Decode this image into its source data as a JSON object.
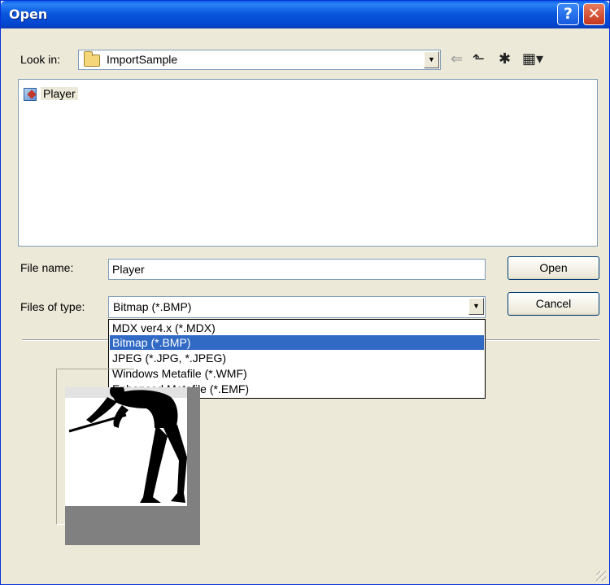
{
  "window": {
    "title": "Open",
    "help_glyph": "?",
    "close_glyph": "✕"
  },
  "lookin": {
    "label": "Look in:",
    "value": "ImportSample",
    "folder_icon": "folder-icon"
  },
  "toolbar": {
    "back_glyph": "⇐",
    "up_glyph": "⬑",
    "newfolder_glyph": "✱",
    "views_glyph": "▦▾"
  },
  "files": [
    {
      "name": "Player",
      "icon": "image-file-icon"
    }
  ],
  "filename": {
    "label": "File name:",
    "value": "Player"
  },
  "filetype": {
    "label": "Files of type:",
    "value": "Bitmap (*.BMP)",
    "options": [
      "MDX ver4.x (*.MDX)",
      "Bitmap (*.BMP)",
      "JPEG (*.JPG, *.JPEG)",
      "Windows Metafile (*.WMF)",
      "Enhanced Metafile (*.EMF)"
    ],
    "selected_index": 1
  },
  "buttons": {
    "open": "Open",
    "cancel": "Cancel"
  },
  "colors": {
    "titlebar": "#0a58de",
    "selection": "#316ac5",
    "dialog_bg": "#ece9d8"
  }
}
